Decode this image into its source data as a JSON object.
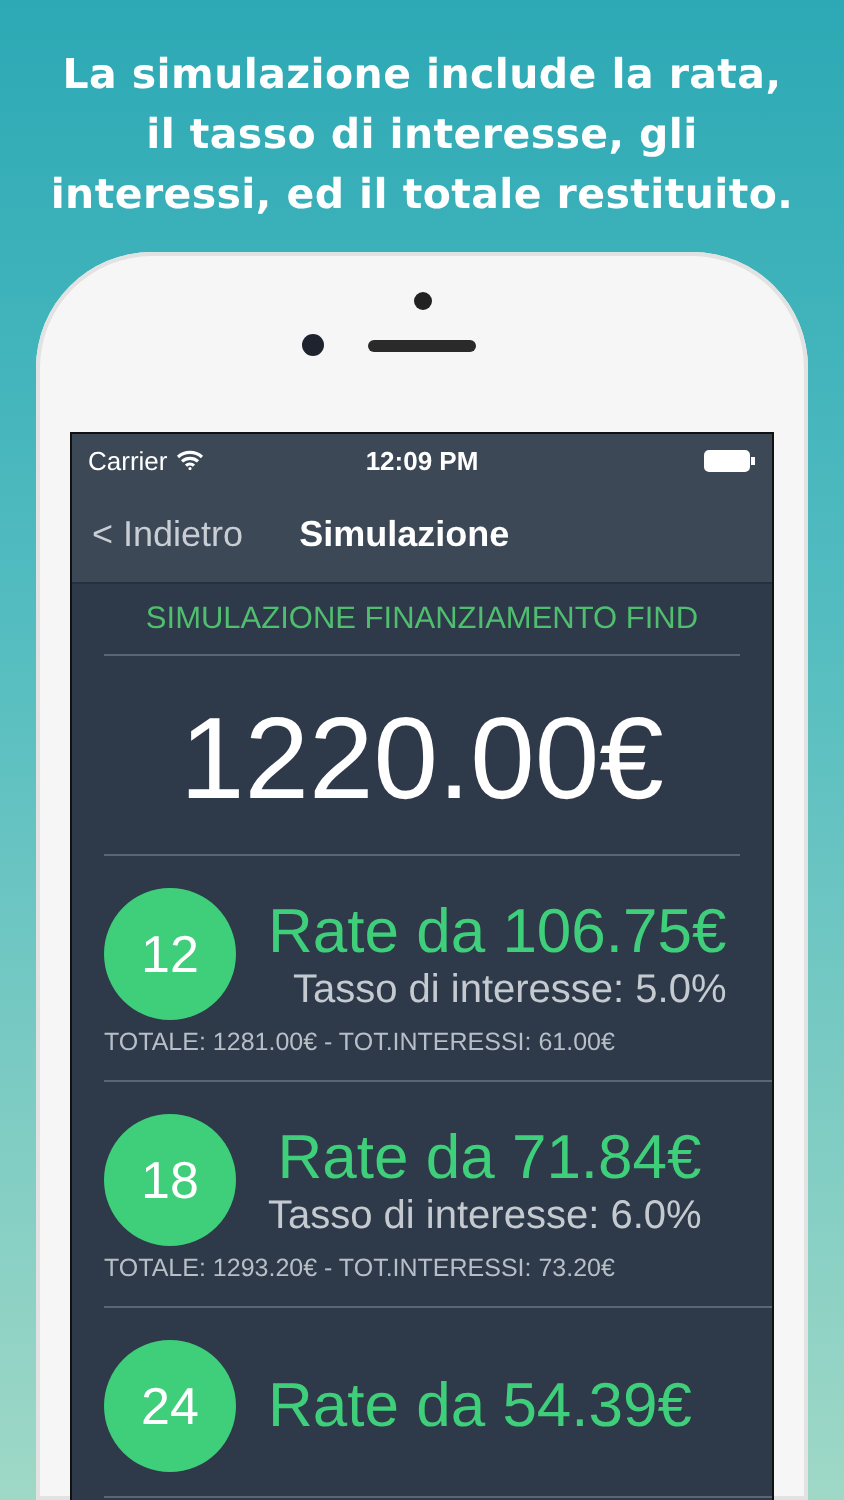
{
  "headline": [
    "La simulazione include la rata,",
    "il tasso di interesse, gli",
    "interessi, ed il totale restituito."
  ],
  "status_bar": {
    "carrier": "Carrier",
    "time": "12:09 PM"
  },
  "nav_bar": {
    "back": "< Indietro",
    "title": "Simulazione"
  },
  "header": "SIMULAZIONE FINANZIAMENTO FIND",
  "amount": "1220.00€",
  "plans": [
    {
      "months": "12",
      "rate": "Rate da 106.75€",
      "interest": "Tasso di interesse: 5.0%",
      "totals": "TOTALE: 1281.00€ - TOT.INTERESSI: 61.00€"
    },
    {
      "months": "18",
      "rate": "Rate da 71.84€",
      "interest": "Tasso di interesse: 6.0%",
      "totals": "TOTALE: 1293.20€ - TOT.INTERESSI: 73.20€"
    },
    {
      "months": "24",
      "rate": "Rate da 54.39€"
    }
  ]
}
